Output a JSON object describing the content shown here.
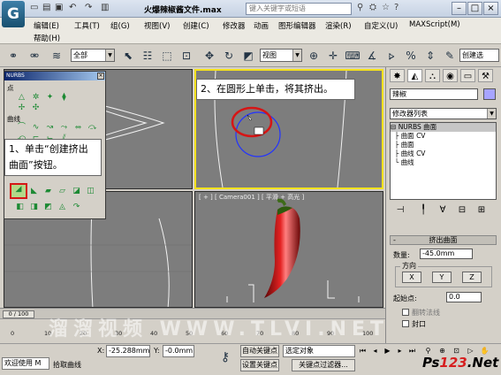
{
  "window": {
    "title": "火爆辣椒酱文件.max",
    "search_placeholder": "键入关键字或短语",
    "app_icon": "3ds-max-logo"
  },
  "menu": {
    "row1": [
      "编辑(E)",
      "工具(T)",
      "组(G)",
      "视图(V)",
      "创建(C)",
      "修改器",
      "动画",
      "图形编辑器",
      "渲染(R)",
      "自定义(U)",
      "MAXScript(M)"
    ],
    "row2": [
      "帮助(H)"
    ]
  },
  "toolbar": {
    "filter_value": "全部",
    "coord_value": "视图",
    "named_set_value": "创建选"
  },
  "nurbs_panel": {
    "title": "NURBS",
    "section_point": "点",
    "section_curve": "曲线",
    "section_surface": "曲面"
  },
  "callouts": {
    "step1": "1、单击“创建挤出曲面”按钮。",
    "step2": "2、在圆形上单击，将其挤出。"
  },
  "viewports": {
    "camera_label": "[ + ] [ Camera001 ] [ 平滑 + 高光 ]"
  },
  "command_panel": {
    "object_name": "辣椒",
    "object_color": "#a7a4ff",
    "modifier_list": "修改器列表",
    "stack": [
      {
        "label": "NURBS 曲面",
        "prefix": "⊟",
        "selected": true
      },
      {
        "label": "曲面 CV",
        "prefix": "├",
        "selected": false
      },
      {
        "label": "曲面",
        "prefix": "├",
        "selected": false
      },
      {
        "label": "曲线 CV",
        "prefix": "├",
        "selected": false
      },
      {
        "label": "曲线",
        "prefix": "└",
        "selected": false
      }
    ],
    "rollout_title": "挤出曲面",
    "amount_label": "数量:",
    "amount_value": "-45.0mm",
    "direction_label": "方向",
    "axis_x": "X",
    "axis_y": "Y",
    "axis_z": "Z",
    "start_point_label": "起始点:",
    "start_point_value": "0.0",
    "flip_normals": "翻转法线",
    "cap": "封口"
  },
  "timeline": {
    "slider": "0 / 100",
    "ticks": [
      "0",
      "10",
      "20",
      "30",
      "40",
      "50",
      "60",
      "70",
      "80",
      "90",
      "100"
    ]
  },
  "status": {
    "welcome": "欢迎使用 M",
    "prompt": "拾取曲线",
    "x_label": "X:",
    "x_value": "-25.288mm",
    "y_label": "Y:",
    "y_value": "-0.0mm",
    "auto_key": "自动关键点",
    "auto_key_value": "选定对象",
    "set_key": "设置关键点",
    "key_filters": "关键点过滤器..."
  },
  "watermark": "溜溜视频 WWW.TLVI.NET",
  "brand": {
    "prefix": "Ps",
    "highlight": "123",
    "suffix": ".Net"
  }
}
